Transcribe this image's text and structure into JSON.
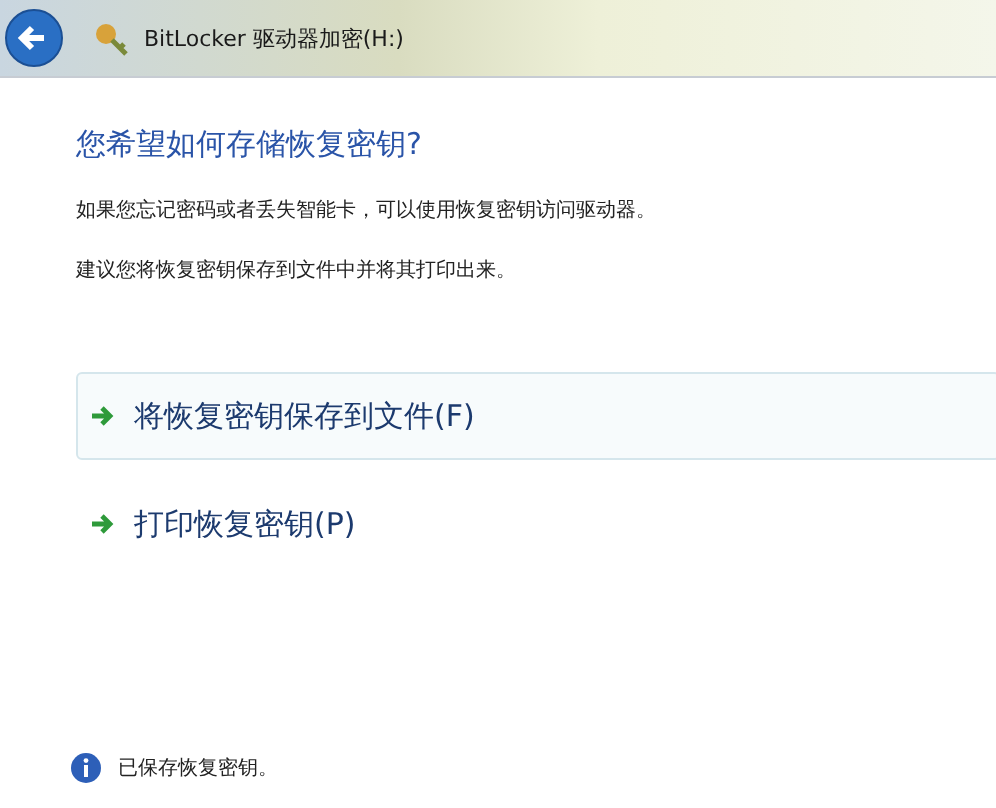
{
  "window": {
    "title": "BitLocker 驱动器加密(H:)"
  },
  "heading": "您希望如何存储恢复密钥?",
  "paragraphs": [
    "如果您忘记密码或者丢失智能卡，可以使用恢复密钥访问驱动器。",
    "建议您将恢复密钥保存到文件中并将其打印出来。"
  ],
  "options": [
    {
      "label": "将恢复密钥保存到文件(F)",
      "selected": true
    },
    {
      "label": "打印恢复密钥(P)",
      "selected": false
    }
  ],
  "status": "已保存恢复密钥。"
}
